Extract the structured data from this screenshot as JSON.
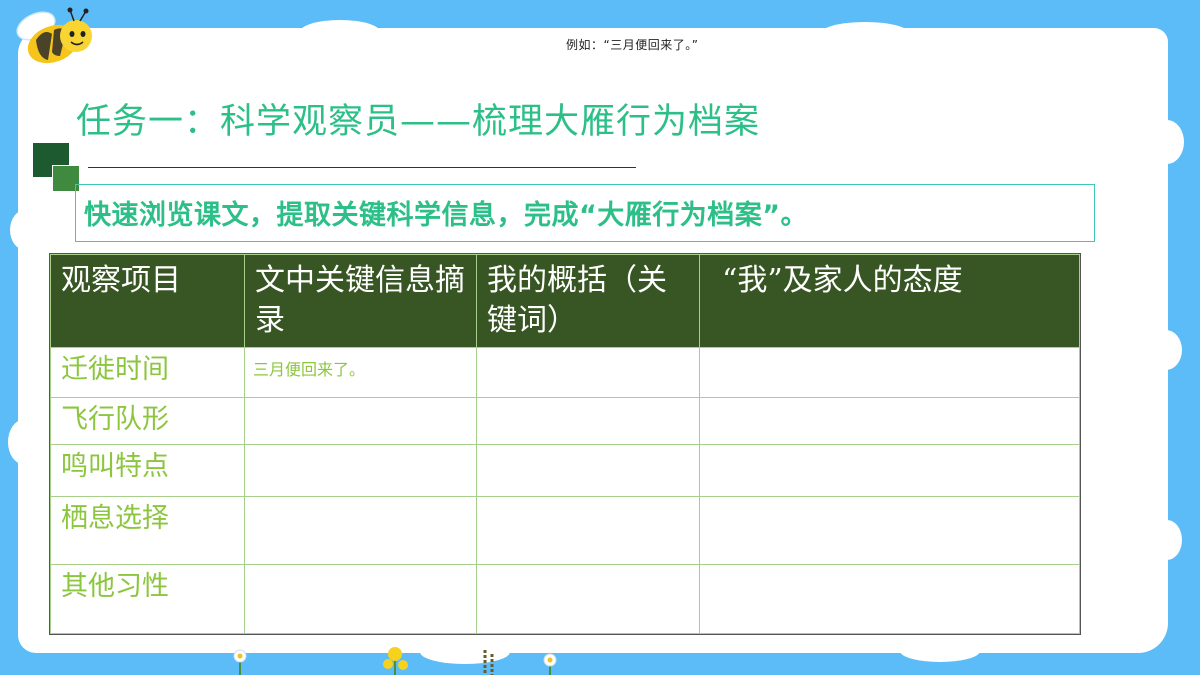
{
  "example_note": "例如：“三月便回来了。”",
  "task_title": "任务一：科学观察员——梳理大雁行为档案",
  "instruction": "快速浏览课文，提取关键科学信息，完成“大雁行为档案”。",
  "table": {
    "headers": [
      "观察项目",
      "文中关键信息摘录",
      "我的概括（关键词）",
      "“我”及家人的态度"
    ],
    "rows": [
      {
        "item": "迁徙时间",
        "quote": "三月便回来了。",
        "summary": "",
        "attitude": ""
      },
      {
        "item": "飞行队形",
        "quote": "",
        "summary": "",
        "attitude": ""
      },
      {
        "item": "鸣叫特点",
        "quote": "",
        "summary": "",
        "attitude": ""
      },
      {
        "item": "栖息选择",
        "quote": "",
        "summary": "",
        "attitude": ""
      },
      {
        "item": "其他习性",
        "quote": "",
        "summary": "",
        "attitude": ""
      }
    ]
  },
  "colors": {
    "background": "#5bbcf7",
    "title_green": "#2dbf88",
    "header_bg": "#375623",
    "row_label": "#8cc63f"
  },
  "icons": [
    "bee-icon",
    "flower-decoration"
  ]
}
